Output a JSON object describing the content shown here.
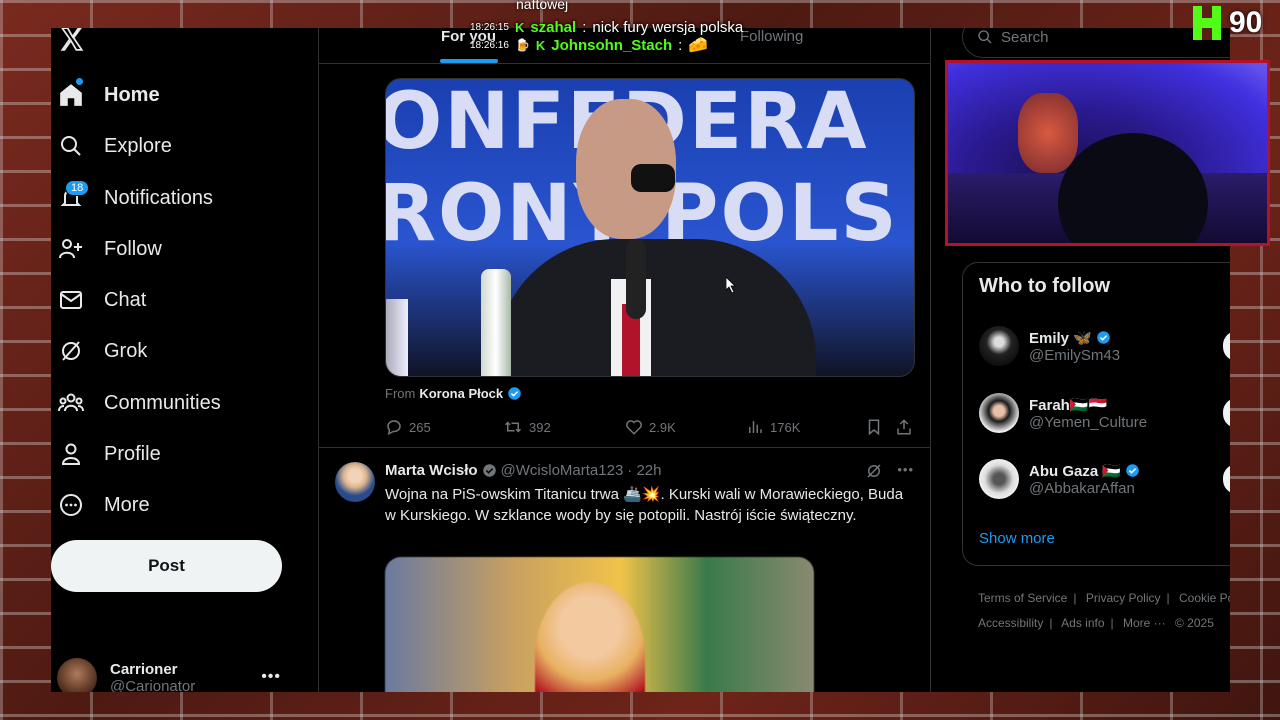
{
  "overlay": {
    "chat_top": "naftowej",
    "chat": [
      {
        "time": "18:26:15",
        "user": "szahal",
        "message": "nick fury wersja polska"
      },
      {
        "time": "18:26:16",
        "user": "Johnsohn_Stach",
        "message": ""
      }
    ],
    "viewer_count": "90"
  },
  "sidebar": {
    "items": [
      {
        "label": "Home",
        "icon": "home-icon"
      },
      {
        "label": "Explore",
        "icon": "search-icon"
      },
      {
        "label": "Notifications",
        "icon": "bell-icon",
        "badge": "18"
      },
      {
        "label": "Follow",
        "icon": "person-add-icon"
      },
      {
        "label": "Chat",
        "icon": "mail-icon"
      },
      {
        "label": "Grok",
        "icon": "grok-icon"
      },
      {
        "label": "Communities",
        "icon": "communities-icon"
      },
      {
        "label": "Profile",
        "icon": "person-icon"
      },
      {
        "label": "More",
        "icon": "more-circle-icon"
      }
    ],
    "post_label": "Post",
    "account": {
      "name": "Carrioner",
      "handle": "@Carionator"
    }
  },
  "tabs": {
    "for_you": "For you",
    "following": "Following"
  },
  "tweet1": {
    "from_prefix": "From",
    "from_name": "Korona Płock",
    "banner_line1": "ONFEDERA",
    "banner_line2": "RONY POLS",
    "stats": {
      "replies": "265",
      "reposts": "392",
      "likes": "2.9K",
      "views": "176K"
    }
  },
  "tweet2": {
    "name": "Marta Wcisło",
    "handle": "@WcisloMarta123",
    "time": "· 22h",
    "text": "Wojna na PiS-owskim Titanicu trwa 🚢💥. Kurski wali w Morawieckiego, Buda w Kurskiego. W szklance wody by się potopili. Nastrój iście świąteczny."
  },
  "right": {
    "search_placeholder": "Search",
    "who_to_follow": {
      "title": "Who to follow",
      "people": [
        {
          "name": "Emily 🦋",
          "handle": "@EmilySm43",
          "verified": true
        },
        {
          "name": "Farah🇵🇸🇾🇪",
          "handle": "@Yemen_Culture",
          "verified": false
        },
        {
          "name": "Abu Gaza 🇵🇸",
          "handle": "@AbbakarAffan",
          "verified": true
        }
      ],
      "show_more": "Show more"
    },
    "footer": {
      "terms": "Terms of Service",
      "privacy": "Privacy Policy",
      "cookie": "Cookie Po",
      "accessibility": "Accessibility",
      "ads": "Ads info",
      "more": "More ···",
      "copyright": "© 2025"
    }
  },
  "colors": {
    "accent": "#1d9bf0",
    "background": "#000000",
    "kick_green": "#53fc18",
    "webcam_border": "#b3122a"
  }
}
